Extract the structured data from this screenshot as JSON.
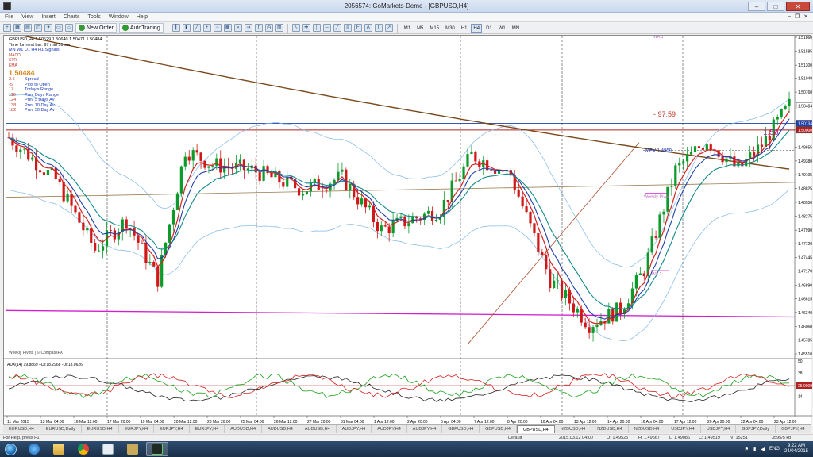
{
  "window": {
    "title": "2056574: GoMarkets-Demo - [GBPUSD,H4]",
    "minimize": "–",
    "maximize": "□",
    "close": "✕"
  },
  "menu": [
    "File",
    "View",
    "Insert",
    "Charts",
    "Tools",
    "Window",
    "Help"
  ],
  "mdi_controls": {
    "minimize": "–",
    "restore": "❐",
    "close": "✕"
  },
  "toolbar": {
    "new_order": "New Order",
    "autotrading": "AutoTrading",
    "timeframes": [
      "M1",
      "M5",
      "M15",
      "M30",
      "H1",
      "H4",
      "D1",
      "W1",
      "MN"
    ],
    "active_timeframe": "H4"
  },
  "chart": {
    "header": "GBPUSD,H4  1.50529 1.50640 1.50471 1.50484",
    "timer": "Time for next bar: 97 min 59 sec",
    "signals_header": "MN  W1  D1  H4  H1  Signals",
    "legend": [
      "MACD",
      "STR",
      "EMA"
    ],
    "price": "1.50484",
    "stats": [
      {
        "num": "2.6",
        "label": "Spread"
      },
      {
        "num": "-5",
        "label": "Pips to Open"
      },
      {
        "num": "17",
        "label": "Today's Range"
      },
      {
        "num": "110",
        "label": "Prev Days Range"
      },
      {
        "num": "124",
        "label": "Prev 5 Days Av"
      },
      {
        "num": "138",
        "label": "Prev 10 Day Av"
      },
      {
        "num": "182",
        "label": "Prev 30 Day Av"
      }
    ],
    "countdown": "97:59",
    "level_label": "1.50",
    "mpv_label": "MPV  1.4959",
    "weekly_pivot_label": "Weekly Pivot",
    "ws1_label": "WS 1",
    "wr1_label": "WR 1",
    "source_note": "Weekly Pivots | © CompassFX",
    "adx_label": "ADX(14) 19.8869  +DI:18.2968  -DI:13.0626",
    "price_axis": [
      "1.51860",
      "1.51585",
      "1.51300",
      "1.51040",
      "1.50760",
      "1.50484",
      "1.50134",
      "1.50000",
      "1.49655",
      "1.49380",
      "1.49105",
      "1.48825",
      "1.48550",
      "1.48275",
      "1.47990",
      "1.47720",
      "1.47445",
      "1.47170",
      "1.46890",
      "1.46615",
      "1.46340",
      "1.46060",
      "1.45785",
      "1.45510"
    ],
    "price_highlight": {
      "current": "1.50484",
      "line": "1.50134",
      "level": "1.50000"
    },
    "adx_axis": [
      "50",
      "38",
      "25.0000",
      "14"
    ],
    "time_axis": [
      "11 Mar 2015",
      "13 Mar 04:00",
      "16 Mar 12:00",
      "17 Mar 20:00",
      "19 Mar 04:00",
      "20 Mar 12:00",
      "23 Mar 20:00",
      "25 Mar 04:00",
      "26 Mar 12:00",
      "27 Mar 20:00",
      "31 Mar 04:00",
      "1 Apr 12:00",
      "2 Apr 20:00",
      "6 Apr 04:00",
      "7 Apr 12:00",
      "8 Apr 20:00",
      "10 Apr 04:00",
      "13 Apr 12:00",
      "14 Apr 20:00",
      "16 Apr 04:00",
      "17 Apr 12:00",
      "20 Apr 20:00",
      "22 Apr 04:00",
      "23 Apr 12:00"
    ]
  },
  "tabs": [
    "EURUSD,H4",
    "EURUSD,Daily",
    "EURUSD,H4",
    "EURJPY,H4",
    "EURJPY,H4",
    "EURJPY,H4",
    "AUDUSD,H4",
    "AUDUSD,H4",
    "AUDUSD,H4",
    "AUDJPY,H4",
    "AUDJPY,H4",
    "AUDJPY,H4",
    "GBPUSD,H4",
    "GBPUSD,H4",
    "GBPUSD,H4",
    "NZDUSD,H4",
    "NZDUSD,H4",
    "NZDUSD,H4",
    "USDJPY,H4",
    "USDJPY,H4",
    "GBPJPY,Daily",
    "GBPJPY,H4",
    "GBPJPY,H4"
  ],
  "active_tab": 14,
  "status": {
    "help": "For Help, press F1",
    "profile": "Default",
    "datetime": "2015.03.12 04:00",
    "open": "O: 1.49525",
    "high": "H: 1.49567",
    "low": "L: 1.49086",
    "close": "C: 1.49519",
    "volume": "V: 15251",
    "traffic": "3595/5 kb"
  },
  "taskbar": {
    "time": "9:22 AM",
    "date": "24/04/2015",
    "lang": "ENG"
  },
  "colors": {
    "bull": "#0a9b2a",
    "bear": "#d01818",
    "ema_red": "#d42020",
    "ema_blue": "#1f3fa8",
    "ema_teal": "#138a8a",
    "sma_brown": "#7a4a1c",
    "band": "#7fb8e8",
    "pivot": "#d020d0",
    "level_line": "#b02020"
  }
}
